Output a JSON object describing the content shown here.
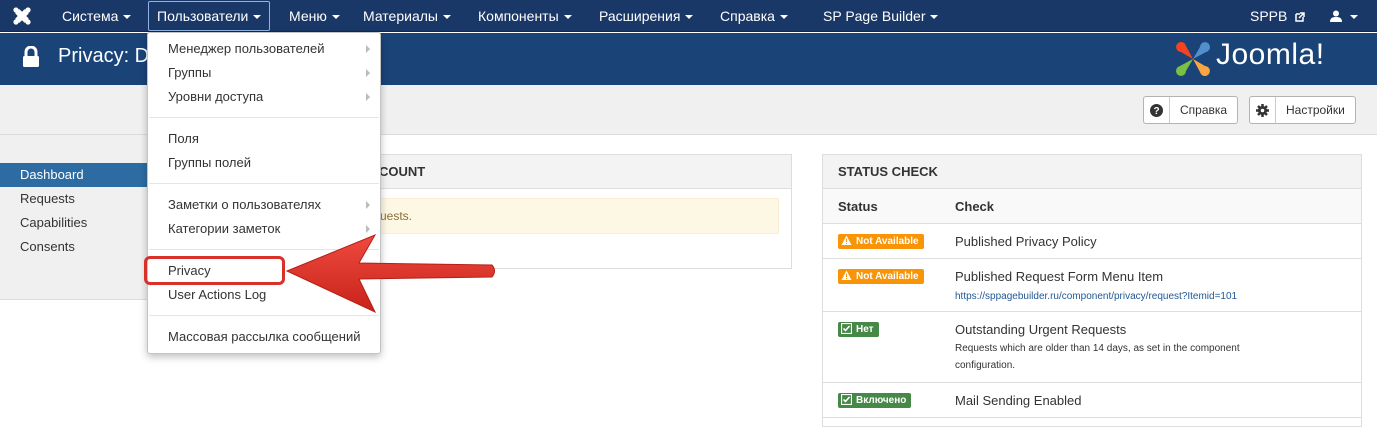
{
  "navbar": {
    "items": [
      {
        "label": "Система"
      },
      {
        "label": "Пользователи"
      },
      {
        "label": "Меню"
      },
      {
        "label": "Материалы"
      },
      {
        "label": "Компоненты"
      },
      {
        "label": "Расширения"
      },
      {
        "label": "Справка"
      },
      {
        "label": "SP Page Builder"
      }
    ],
    "right_link": "SPPB",
    "user_icon": "user-icon"
  },
  "header": {
    "title": "Privacy: D",
    "brand": "Joomla!"
  },
  "toolbar": {
    "help_label": "Справка",
    "options_label": "Настройки"
  },
  "sidebar": {
    "items": [
      {
        "label": "Dashboard",
        "active": true
      },
      {
        "label": "Requests"
      },
      {
        "label": "Capabilities"
      },
      {
        "label": "Consents"
      }
    ]
  },
  "mid_panel": {
    "title_fragment": "COUNT",
    "alert_fragment": "uests."
  },
  "status_check": {
    "title": "STATUS CHECK",
    "col_status": "Status",
    "col_check": "Check",
    "rows": [
      {
        "badge": "Not Available",
        "check": "Published Privacy Policy"
      },
      {
        "badge": "Not Available",
        "check": "Published Request Form Menu Item",
        "link": "https://sppagebuilder.ru/component/privacy/request?Itemid=101"
      },
      {
        "badge": "Нет",
        "check": "Outstanding Urgent Requests",
        "sub_line1": "Requests which are older than 14 days, as set in the component",
        "sub_line2": "configuration."
      },
      {
        "badge": "Включено",
        "check": "Mail Sending Enabled"
      }
    ]
  },
  "dropdown": {
    "items": [
      {
        "label": "Менеджер пользователей"
      },
      {
        "label": "Группы"
      },
      {
        "label": "Уровни доступа"
      },
      {
        "label": "Поля"
      },
      {
        "label": "Группы полей"
      },
      {
        "label": "Заметки о пользователях"
      },
      {
        "label": "Категории заметок"
      },
      {
        "label": "Privacy"
      },
      {
        "label": "User Actions Log"
      },
      {
        "label": "Массовая рассылка сообщений"
      }
    ]
  },
  "colors": {
    "navbar": "#1a3867",
    "header": "#1a4378",
    "active_sidebar": "#2d6ca2",
    "warning_badge": "#f89406",
    "success_badge": "#468847",
    "highlight": "#d9302a"
  }
}
